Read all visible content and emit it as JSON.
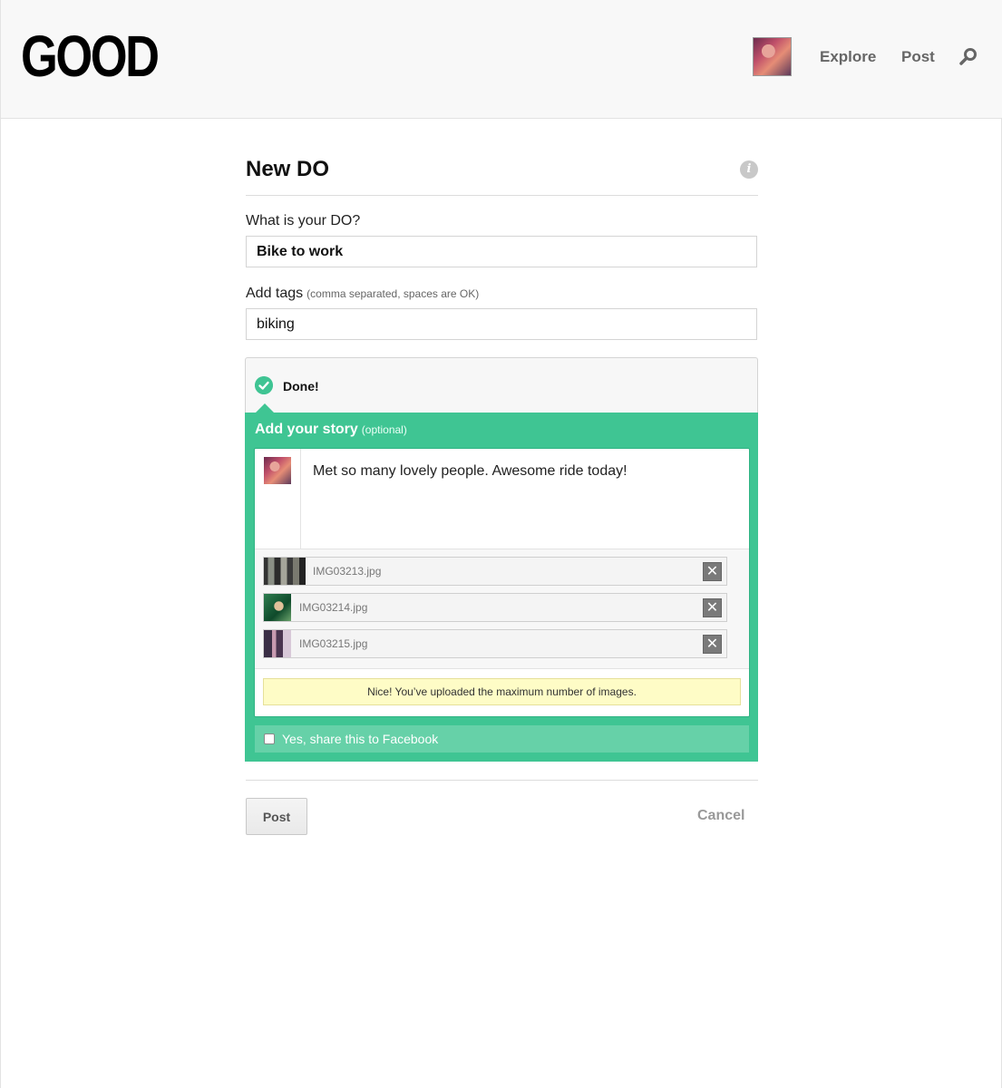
{
  "header": {
    "logo": "GOOD",
    "nav": {
      "explore": "Explore",
      "post": "Post"
    },
    "icons": {
      "avatar": "user-avatar",
      "search": "search-icon"
    }
  },
  "form": {
    "title": "New DO",
    "info_icon_glyph": "i",
    "do_label": "What is your DO?",
    "do_value": "Bike to work",
    "tags_label": "Add tags",
    "tags_hint": "(comma separated, spaces are OK)",
    "tags_value": "biking"
  },
  "done": {
    "label": "Done!"
  },
  "story": {
    "title": "Add your story",
    "optional": "(optional)",
    "text": "Met so many lovely people. Awesome ride today!",
    "uploads": [
      {
        "name": "IMG03213.jpg"
      },
      {
        "name": "IMG03214.jpg"
      },
      {
        "name": "IMG03215.jpg"
      }
    ],
    "remove_glyph": "✕",
    "notice": "Nice! You’ve uploaded the maximum number of images.",
    "facebook_label": "Yes, share this to Facebook",
    "facebook_checked": false
  },
  "actions": {
    "post": "Post",
    "cancel": "Cancel"
  },
  "colors": {
    "accent_green": "#3fc593",
    "notice_bg": "#fefcc6"
  }
}
